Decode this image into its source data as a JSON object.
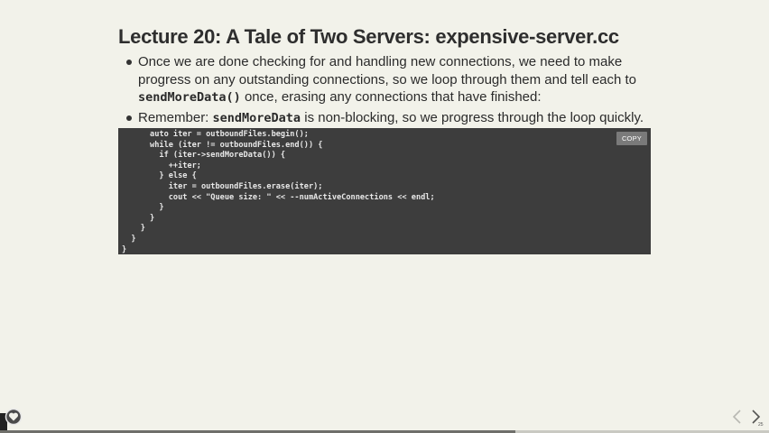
{
  "slide": {
    "title": "Lecture 20: A Tale of Two Servers: expensive-server.cc",
    "bullets": [
      {
        "text_1": "Once we are done checking for and handling new connections, we need to make progress on any outstanding connections, so we loop through them and tell each to ",
        "code": "sendMoreData()",
        "text_2": " once, erasing any connections that have finished:"
      },
      {
        "text_1": "Remember: ",
        "code": "sendMoreData",
        "text_2": " is non-blocking, so we progress through the loop quickly."
      }
    ],
    "code_lines": [
      "      auto iter = outboundFiles.begin();",
      "      while (iter != outboundFiles.end()) {",
      "        if (iter->sendMoreData()) {",
      "          ++iter;",
      "        } else {",
      "          iter = outboundFiles.erase(iter);",
      "          cout << \"Queue size: \" << --numActiveConnections << endl;",
      "        }",
      "      }",
      "    }",
      "  }",
      "}"
    ],
    "copy_label": "COPY",
    "slide_number": "25"
  },
  "navigation": {
    "progress": 0.67,
    "prev_icon": "chevron-left-icon",
    "next_icon": "chevron-right-icon"
  },
  "colors": {
    "background": "#f2f2ea",
    "code_background": "#3d3d3d",
    "copy_button": "#7a7a7a"
  }
}
